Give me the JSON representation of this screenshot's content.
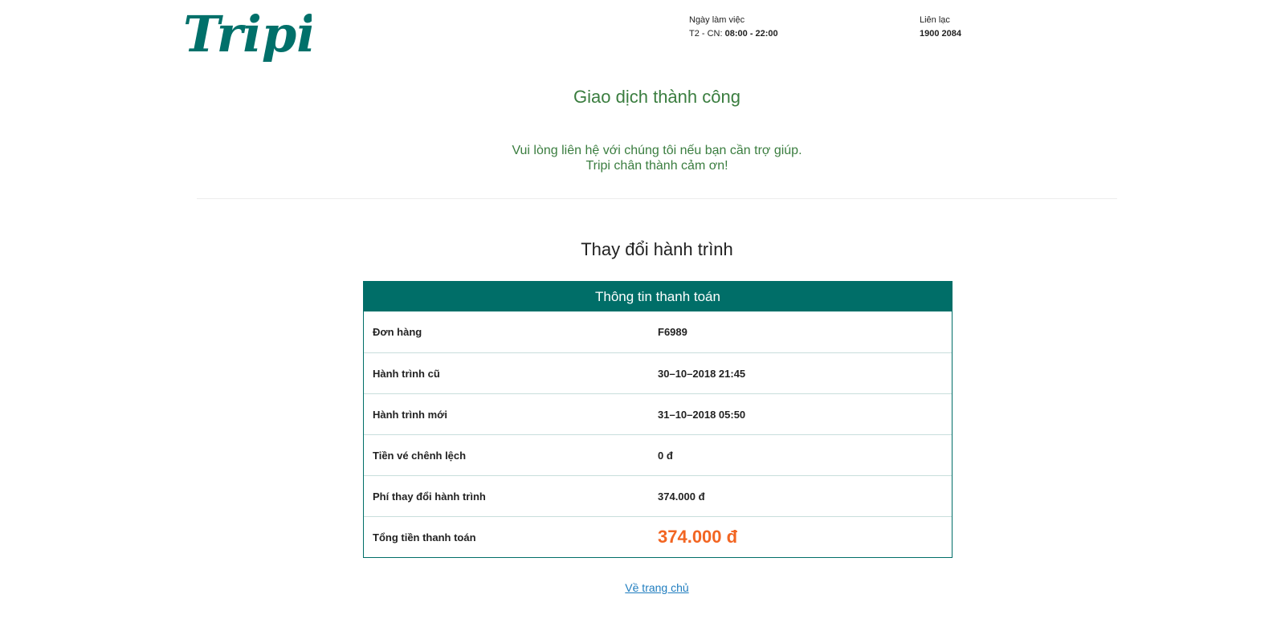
{
  "header": {
    "logo_text": "Tripi",
    "hours_label": "Ngày làm việc",
    "hours_days": "T2 - CN:",
    "hours_time": "08:00 - 22:00",
    "contact_label": "Liên lạc",
    "contact_phone": "1900 2084"
  },
  "status": {
    "title": "Giao dịch thành công",
    "help_line1": "Vui lòng liên hệ với chúng tôi nếu bạn cần trợ giúp.",
    "help_line2": "Tripi chân thành cảm ơn!"
  },
  "section": {
    "title": "Thay đổi hành trình"
  },
  "payment_table": {
    "header": "Thông tin thanh toán",
    "rows": [
      {
        "label": "Đơn hàng",
        "value": "F6989"
      },
      {
        "label": "Hành trình cũ",
        "value": "30–10–2018 21:45"
      },
      {
        "label": "Hành trình mới",
        "value": "31–10–2018 05:50"
      },
      {
        "label": "Tiền vé chênh lệch",
        "value": "0 đ"
      },
      {
        "label": "Phí thay đổi hành trình",
        "value": "374.000 đ"
      },
      {
        "label": "Tổng tiền thanh toán",
        "value": "374.000 đ"
      }
    ]
  },
  "footer": {
    "home_link": "Về trang chủ"
  },
  "colors": {
    "brand": "#006e68",
    "success": "#3a7d3f",
    "total": "#f26522",
    "link": "#1f7dbf"
  }
}
